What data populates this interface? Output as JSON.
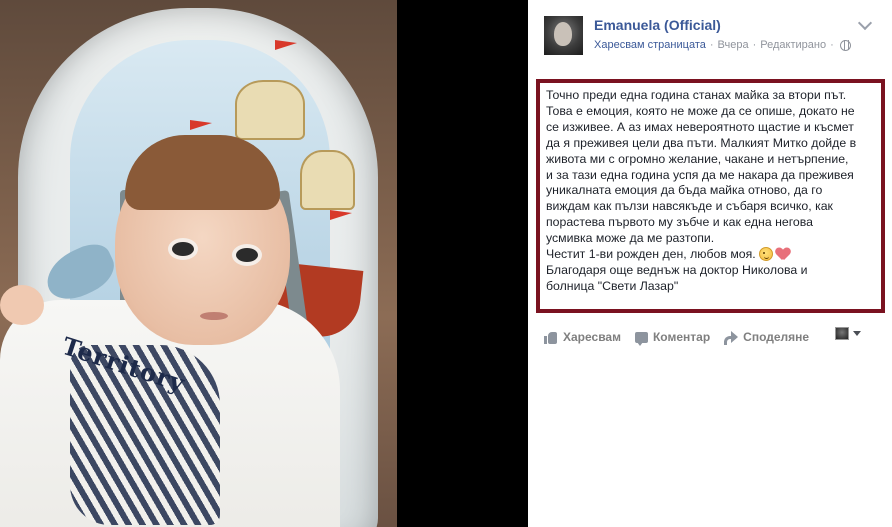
{
  "photo": {
    "shirt_print": "Territory"
  },
  "post": {
    "author": "Emanuela (Official)",
    "like_page": "Харесвам страницата",
    "separator": "·",
    "time": "Вчера",
    "edited": "Редактирано",
    "text_lines": [
      "Точно преди една година станах майка за втори път.",
      "Това е емоция, която не може да се опише, докато не",
      "се изживее. А аз имах невероятното щастие и късмет",
      "да я преживея цели два пъти. Малкият Митко дойде в",
      "живота ми с огромно желание, чакане и нетърпение,",
      "и за тази една година успя да ме накара да преживея",
      "уникалната емоция да бъда майка отново, да го",
      "виждам как пълзи навсякъде и събаря всичко, как",
      "порастева първото му зъбче и как една негова",
      "усмивка може да ме разтопи."
    ],
    "birthday_line": "Честит 1-ви рожден ден, любов моя.",
    "thanks_lines": [
      "Благодаря още веднъж на доктор Николова и",
      "болница \"Свети Лазар\""
    ],
    "highlight_border_color": "#7a1220",
    "author_color": "#3b5998"
  },
  "actions": {
    "like": "Харесвам",
    "comment": "Коментар",
    "share": "Споделяне"
  }
}
